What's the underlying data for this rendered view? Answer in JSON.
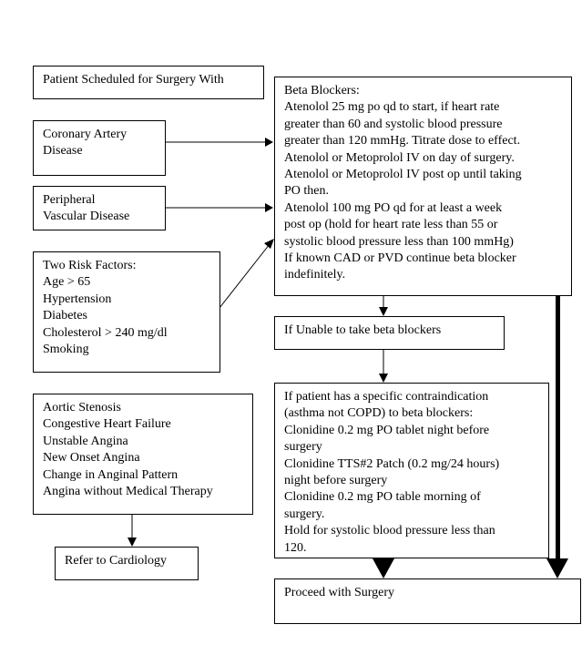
{
  "boxes": {
    "start": {
      "lines": [
        "Patient Scheduled for Surgery With"
      ]
    },
    "cad": {
      "lines": [
        "Coronary Artery",
        "Disease"
      ]
    },
    "pvd": {
      "lines": [
        "Peripheral",
        "Vascular Disease"
      ]
    },
    "risk": {
      "lines": [
        "Two Risk Factors:",
        "Age > 65",
        "Hypertension",
        "Diabetes",
        "Cholesterol > 240 mg/dl",
        "Smoking"
      ]
    },
    "beta": {
      "lines": [
        "Beta Blockers:",
        "Atenolol 25 mg po qd to start, if heart rate",
        "greater than 60 and systolic blood pressure",
        "greater than 120 mmHg. Titrate dose to effect.",
        "Atenolol or Metoprolol IV on day of surgery.",
        "Atenolol or Metoprolol IV post op until taking",
        "PO then.",
        "Atenolol 100 mg PO qd for at least a week",
        "post op (hold for heart rate less than 55 or",
        "systolic blood pressure less than 100 mmHg)",
        "If known CAD or PVD continue beta blocker",
        "indefinitely."
      ]
    },
    "unable": {
      "lines": [
        "If Unable to take beta blockers"
      ]
    },
    "clonidine": {
      "lines": [
        "If patient has a specific contraindication",
        "(asthma not COPD) to beta blockers:",
        "Clonidine 0.2 mg PO tablet night before",
        "surgery",
        "Clonidine TTS#2 Patch (0.2 mg/24 hours)",
        "night before surgery",
        "Clonidine 0.2 mg PO table morning of",
        "surgery.",
        "Hold for systolic blood pressure less than",
        "120."
      ]
    },
    "cardiac": {
      "lines": [
        "Aortic Stenosis",
        "Congestive Heart Failure",
        "Unstable Angina",
        "New Onset Angina",
        "Change in Anginal Pattern",
        "Angina without Medical Therapy"
      ]
    },
    "refer": {
      "lines": [
        "Refer to Cardiology"
      ]
    },
    "proceed": {
      "lines": [
        "Proceed with Surgery"
      ]
    }
  }
}
